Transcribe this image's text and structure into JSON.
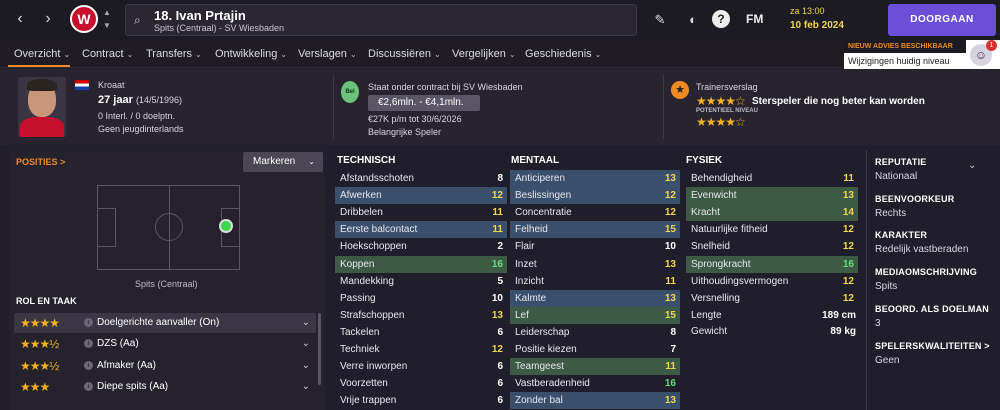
{
  "nav": {
    "back": "‹",
    "forward": "›"
  },
  "player": {
    "number_name": "18. Ivan Prtajin",
    "subtitle": "Spits (Centraal) - SV Wiesbaden"
  },
  "datetime": {
    "time": "za 13:00",
    "date": "10 feb 2024"
  },
  "continue_label": "DOORGAAN",
  "fm_label": "FM",
  "notification": {
    "title": "NIEUW ADVIES BESCHIKBAAR",
    "text": "Wijzigingen huidig niveau",
    "badge": "1"
  },
  "tabs": [
    "Overzicht",
    "Contract",
    "Transfers",
    "Ontwikkeling",
    "Verslagen",
    "Discussiëren",
    "Vergelijken",
    "Geschiedenis"
  ],
  "bio": {
    "nationality": "Kroaat",
    "age": "27 jaar",
    "dob": "(14/5/1996)",
    "caps": "0 Interl. / 0 doelptn.",
    "youth": "Geen jeugdinterlands"
  },
  "contract": {
    "badge": "Bel",
    "title": "Staat onder contract bij SV Wiesbaden",
    "value": "€2,6mln. - €4,1mln.",
    "wage": "€27K p/m tot 30/6/2026",
    "status": "Belangrijke Speler"
  },
  "scout": {
    "title": "Trainersverslag",
    "current_stars": "★★★★☆",
    "text": "Sterspeler die nog beter kan worden",
    "potential_label": "POTENTIEEL NIVEAU",
    "potential_stars": "★★★★☆"
  },
  "positions": {
    "title": "POSITIES >",
    "markeren": "Markeren",
    "position_label": "Spits (Centraal)"
  },
  "roles": {
    "title": "ROL EN TAAK",
    "items": [
      {
        "stars": "★★★★",
        "name": "Doelgerichte aanvaller (On)"
      },
      {
        "stars": "★★★½",
        "name": "DZS (Aa)"
      },
      {
        "stars": "★★★½",
        "name": "Afmaker (Aa)"
      },
      {
        "stars": "★★★",
        "name": "Diepe spits (Aa)"
      }
    ]
  },
  "technical": {
    "title": "TECHNISCH",
    "rows": [
      {
        "name": "Afstandsschoten",
        "value": "8"
      },
      {
        "name": "Afwerken",
        "value": "12"
      },
      {
        "name": "Dribbelen",
        "value": "11"
      },
      {
        "name": "Eerste balcontact",
        "value": "11"
      },
      {
        "name": "Hoekschoppen",
        "value": "2"
      },
      {
        "name": "Koppen",
        "value": "16"
      },
      {
        "name": "Mandekking",
        "value": "5"
      },
      {
        "name": "Passing",
        "value": "10"
      },
      {
        "name": "Strafschoppen",
        "value": "13"
      },
      {
        "name": "Tackelen",
        "value": "6"
      },
      {
        "name": "Techniek",
        "value": "12"
      },
      {
        "name": "Verre inworpen",
        "value": "6"
      },
      {
        "name": "Voorzetten",
        "value": "6"
      },
      {
        "name": "Vrije trappen",
        "value": "6"
      }
    ]
  },
  "mental": {
    "title": "MENTAAL",
    "rows": [
      {
        "name": "Anticiperen",
        "value": "13"
      },
      {
        "name": "Beslissingen",
        "value": "12"
      },
      {
        "name": "Concentratie",
        "value": "12"
      },
      {
        "name": "Felheid",
        "value": "15"
      },
      {
        "name": "Flair",
        "value": "10"
      },
      {
        "name": "Inzet",
        "value": "13"
      },
      {
        "name": "Inzicht",
        "value": "11"
      },
      {
        "name": "Kalmte",
        "value": "13"
      },
      {
        "name": "Lef",
        "value": "15"
      },
      {
        "name": "Leiderschap",
        "value": "8"
      },
      {
        "name": "Positie kiezen",
        "value": "7"
      },
      {
        "name": "Teamgeest",
        "value": "11"
      },
      {
        "name": "Vastberadenheid",
        "value": "16"
      },
      {
        "name": "Zonder bal",
        "value": "13"
      }
    ]
  },
  "physical": {
    "title": "FYSIEK",
    "rows": [
      {
        "name": "Behendigheid",
        "value": "11"
      },
      {
        "name": "Evenwicht",
        "value": "13"
      },
      {
        "name": "Kracht",
        "value": "14"
      },
      {
        "name": "Natuurlijke fitheid",
        "value": "12"
      },
      {
        "name": "Snelheid",
        "value": "12"
      },
      {
        "name": "Sprongkracht",
        "value": "16"
      },
      {
        "name": "Uithoudingsvermogen",
        "value": "12"
      },
      {
        "name": "Versnelling",
        "value": "12"
      }
    ],
    "length_label": "Lengte",
    "length_value": "189 cm",
    "weight_label": "Gewicht",
    "weight_value": "89 kg"
  },
  "right_panel": [
    {
      "heading": "REPUTATIE",
      "value": "Nationaal"
    },
    {
      "heading": "BEENVOORKEUR",
      "value": "Rechts"
    },
    {
      "heading": "KARAKTER",
      "value": "Redelijk vastberaden"
    },
    {
      "heading": "MEDIAOMSCHRIJVING",
      "value": "Spits"
    },
    {
      "heading": "BEOORD. ALS DOELMAN",
      "value": "3"
    },
    {
      "heading": "SPELERSKWALITEITEN >",
      "value": "Geen"
    }
  ],
  "colors": {
    "accent": "#6b4fd8",
    "highlight_blue": "#3a4f6b",
    "highlight_green": "#3c5a44",
    "value_yellow": "#f2d74c",
    "value_green": "#5fe27a",
    "value_white": "#ffffff",
    "orange": "#f08a24"
  }
}
